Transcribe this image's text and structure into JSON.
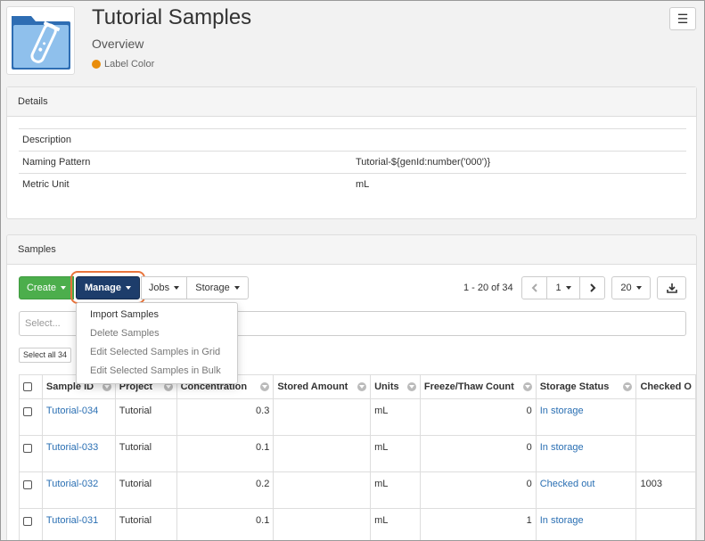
{
  "header": {
    "title": "Tutorial Samples",
    "subtitle": "Overview",
    "label_color_text": "Label Color",
    "label_color": "#e98d0b",
    "menu_icon": "hamburger-icon"
  },
  "details": {
    "heading": "Details",
    "rows": [
      {
        "label": "Description",
        "value": ""
      },
      {
        "label": "Naming Pattern",
        "value": "Tutorial-${genId:number('000')}"
      },
      {
        "label": "Metric Unit",
        "value": "mL"
      }
    ]
  },
  "samples": {
    "heading": "Samples",
    "toolbar": {
      "create": "Create",
      "manage": "Manage",
      "jobs": "Jobs",
      "storage": "Storage"
    },
    "paging": {
      "range_text": "1 - 20 of 34",
      "page": "1",
      "page_size": "20"
    },
    "search_placeholder": "Select...",
    "select_all": "Select all 34",
    "manage_menu": [
      {
        "label": "Import Samples",
        "enabled": true
      },
      {
        "label": "Delete Samples",
        "enabled": false
      },
      {
        "label": "Edit Selected Samples in Grid",
        "enabled": false
      },
      {
        "label": "Edit Selected Samples in Bulk",
        "enabled": false
      }
    ],
    "columns": [
      "Sample ID",
      "Project",
      "Concentration",
      "Stored Amount",
      "Units",
      "Freeze/Thaw Count",
      "Storage Status",
      "Checked O"
    ],
    "rows": [
      {
        "id": "Tutorial-034",
        "project": "Tutorial",
        "concentration": "0.3",
        "stored": "",
        "units": "mL",
        "freeze": "0",
        "status": "In storage",
        "checked": ""
      },
      {
        "id": "Tutorial-033",
        "project": "Tutorial",
        "concentration": "0.1",
        "stored": "",
        "units": "mL",
        "freeze": "0",
        "status": "In storage",
        "checked": ""
      },
      {
        "id": "Tutorial-032",
        "project": "Tutorial",
        "concentration": "0.2",
        "stored": "",
        "units": "mL",
        "freeze": "0",
        "status": "Checked out",
        "checked": "1003"
      },
      {
        "id": "Tutorial-031",
        "project": "Tutorial",
        "concentration": "0.1",
        "stored": "",
        "units": "mL",
        "freeze": "1",
        "status": "In storage",
        "checked": ""
      }
    ]
  },
  "colors": {
    "create_button": "#4cae4c",
    "manage_button": "#1d3d6b",
    "highlight_ring": "#e8743b",
    "link": "#2a6fb3"
  }
}
